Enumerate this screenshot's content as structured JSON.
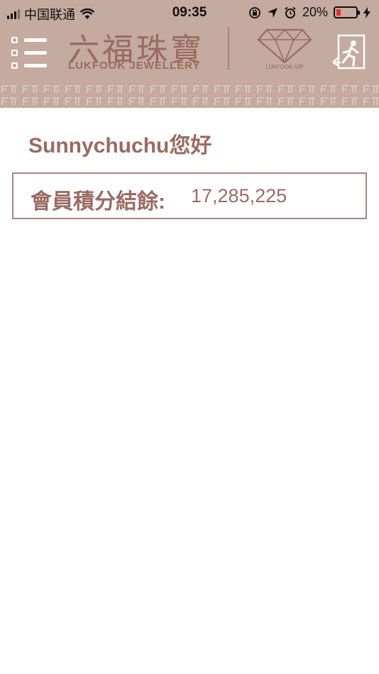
{
  "status_bar": {
    "carrier": "中国联通",
    "time": "09:35",
    "battery": "20%",
    "battery_level": 0.2
  },
  "header": {
    "brand_cn": "六福珠寶",
    "brand_en": "LUKFOOK JEWELLERY",
    "vip_label": "LUKFOOK VIP",
    "icons": [
      "menu-icon",
      "diamond-icon",
      "exit-icon"
    ],
    "colors": {
      "header_bg": "#c4aa9f",
      "brand": "#9a6a64"
    }
  },
  "main": {
    "greeting": "Sunnychuchu您好",
    "points_label": "會員積分結餘:",
    "points_value": "17,285,225"
  }
}
